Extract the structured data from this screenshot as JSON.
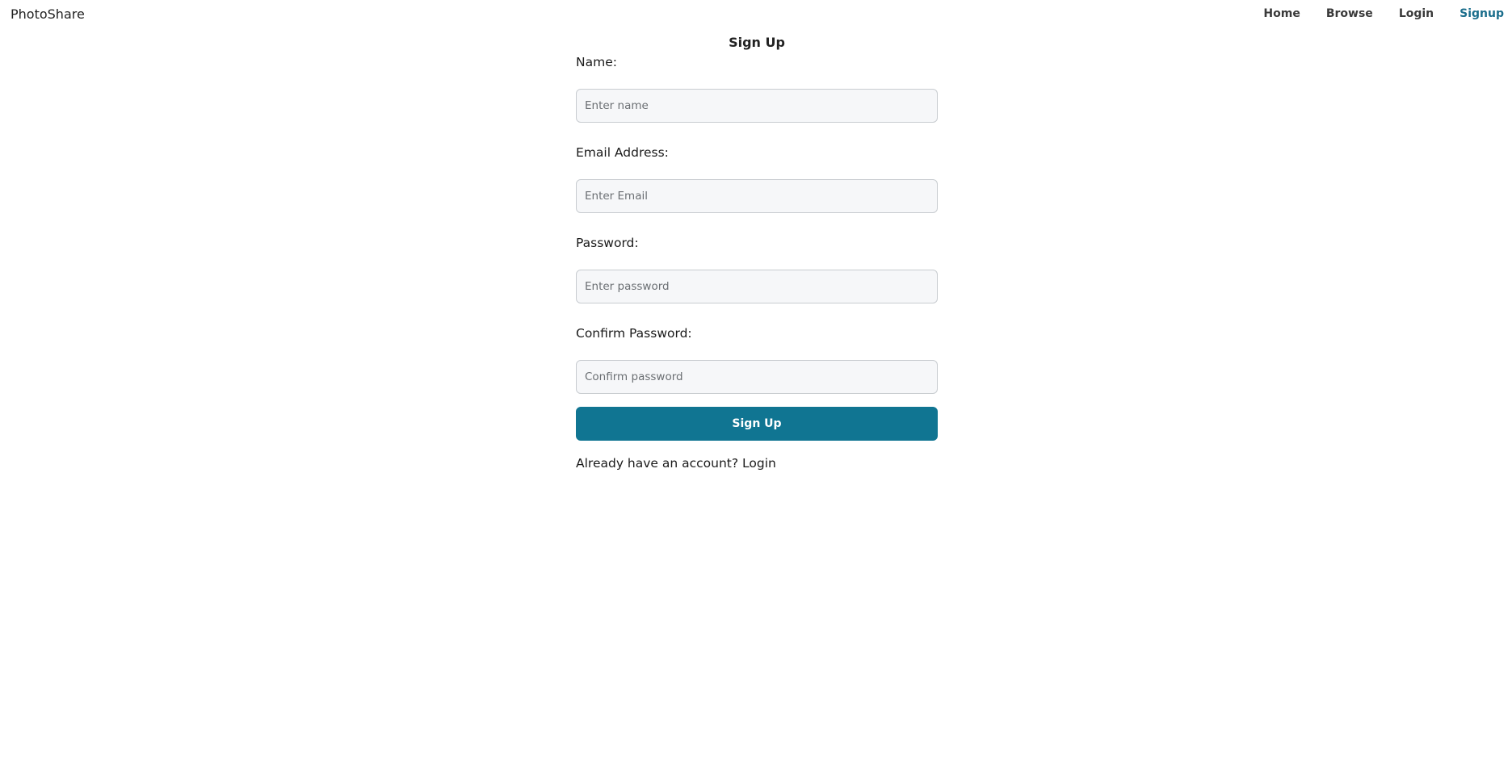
{
  "header": {
    "brand": "PhotoShare",
    "nav": [
      {
        "label": "Home"
      },
      {
        "label": "Browse"
      },
      {
        "label": "Login"
      },
      {
        "label": "Signup"
      }
    ],
    "active_color": "#1b6e8c"
  },
  "form": {
    "title": "Sign Up",
    "fields": [
      {
        "label": "Name:",
        "placeholder": "Enter name",
        "value": ""
      },
      {
        "label": "Email Address:",
        "placeholder": "Enter Email",
        "value": ""
      },
      {
        "label": "Password:",
        "placeholder": "Enter password",
        "value": ""
      },
      {
        "label": "Confirm Password:",
        "placeholder": "Confirm password",
        "value": ""
      }
    ],
    "submit_label": "Sign Up",
    "submit_color": "#107592",
    "footer_text": "Already have an account?",
    "footer_link": "Login"
  }
}
